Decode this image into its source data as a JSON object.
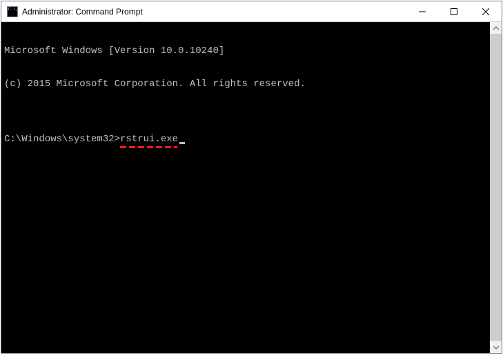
{
  "window": {
    "title": "Administrator: Command Prompt"
  },
  "terminal": {
    "line1": "Microsoft Windows [Version 10.0.10240]",
    "line2": "(c) 2015 Microsoft Corporation. All rights reserved.",
    "blank": "",
    "prompt": "C:\\Windows\\system32>",
    "command": "rstrui.exe"
  }
}
